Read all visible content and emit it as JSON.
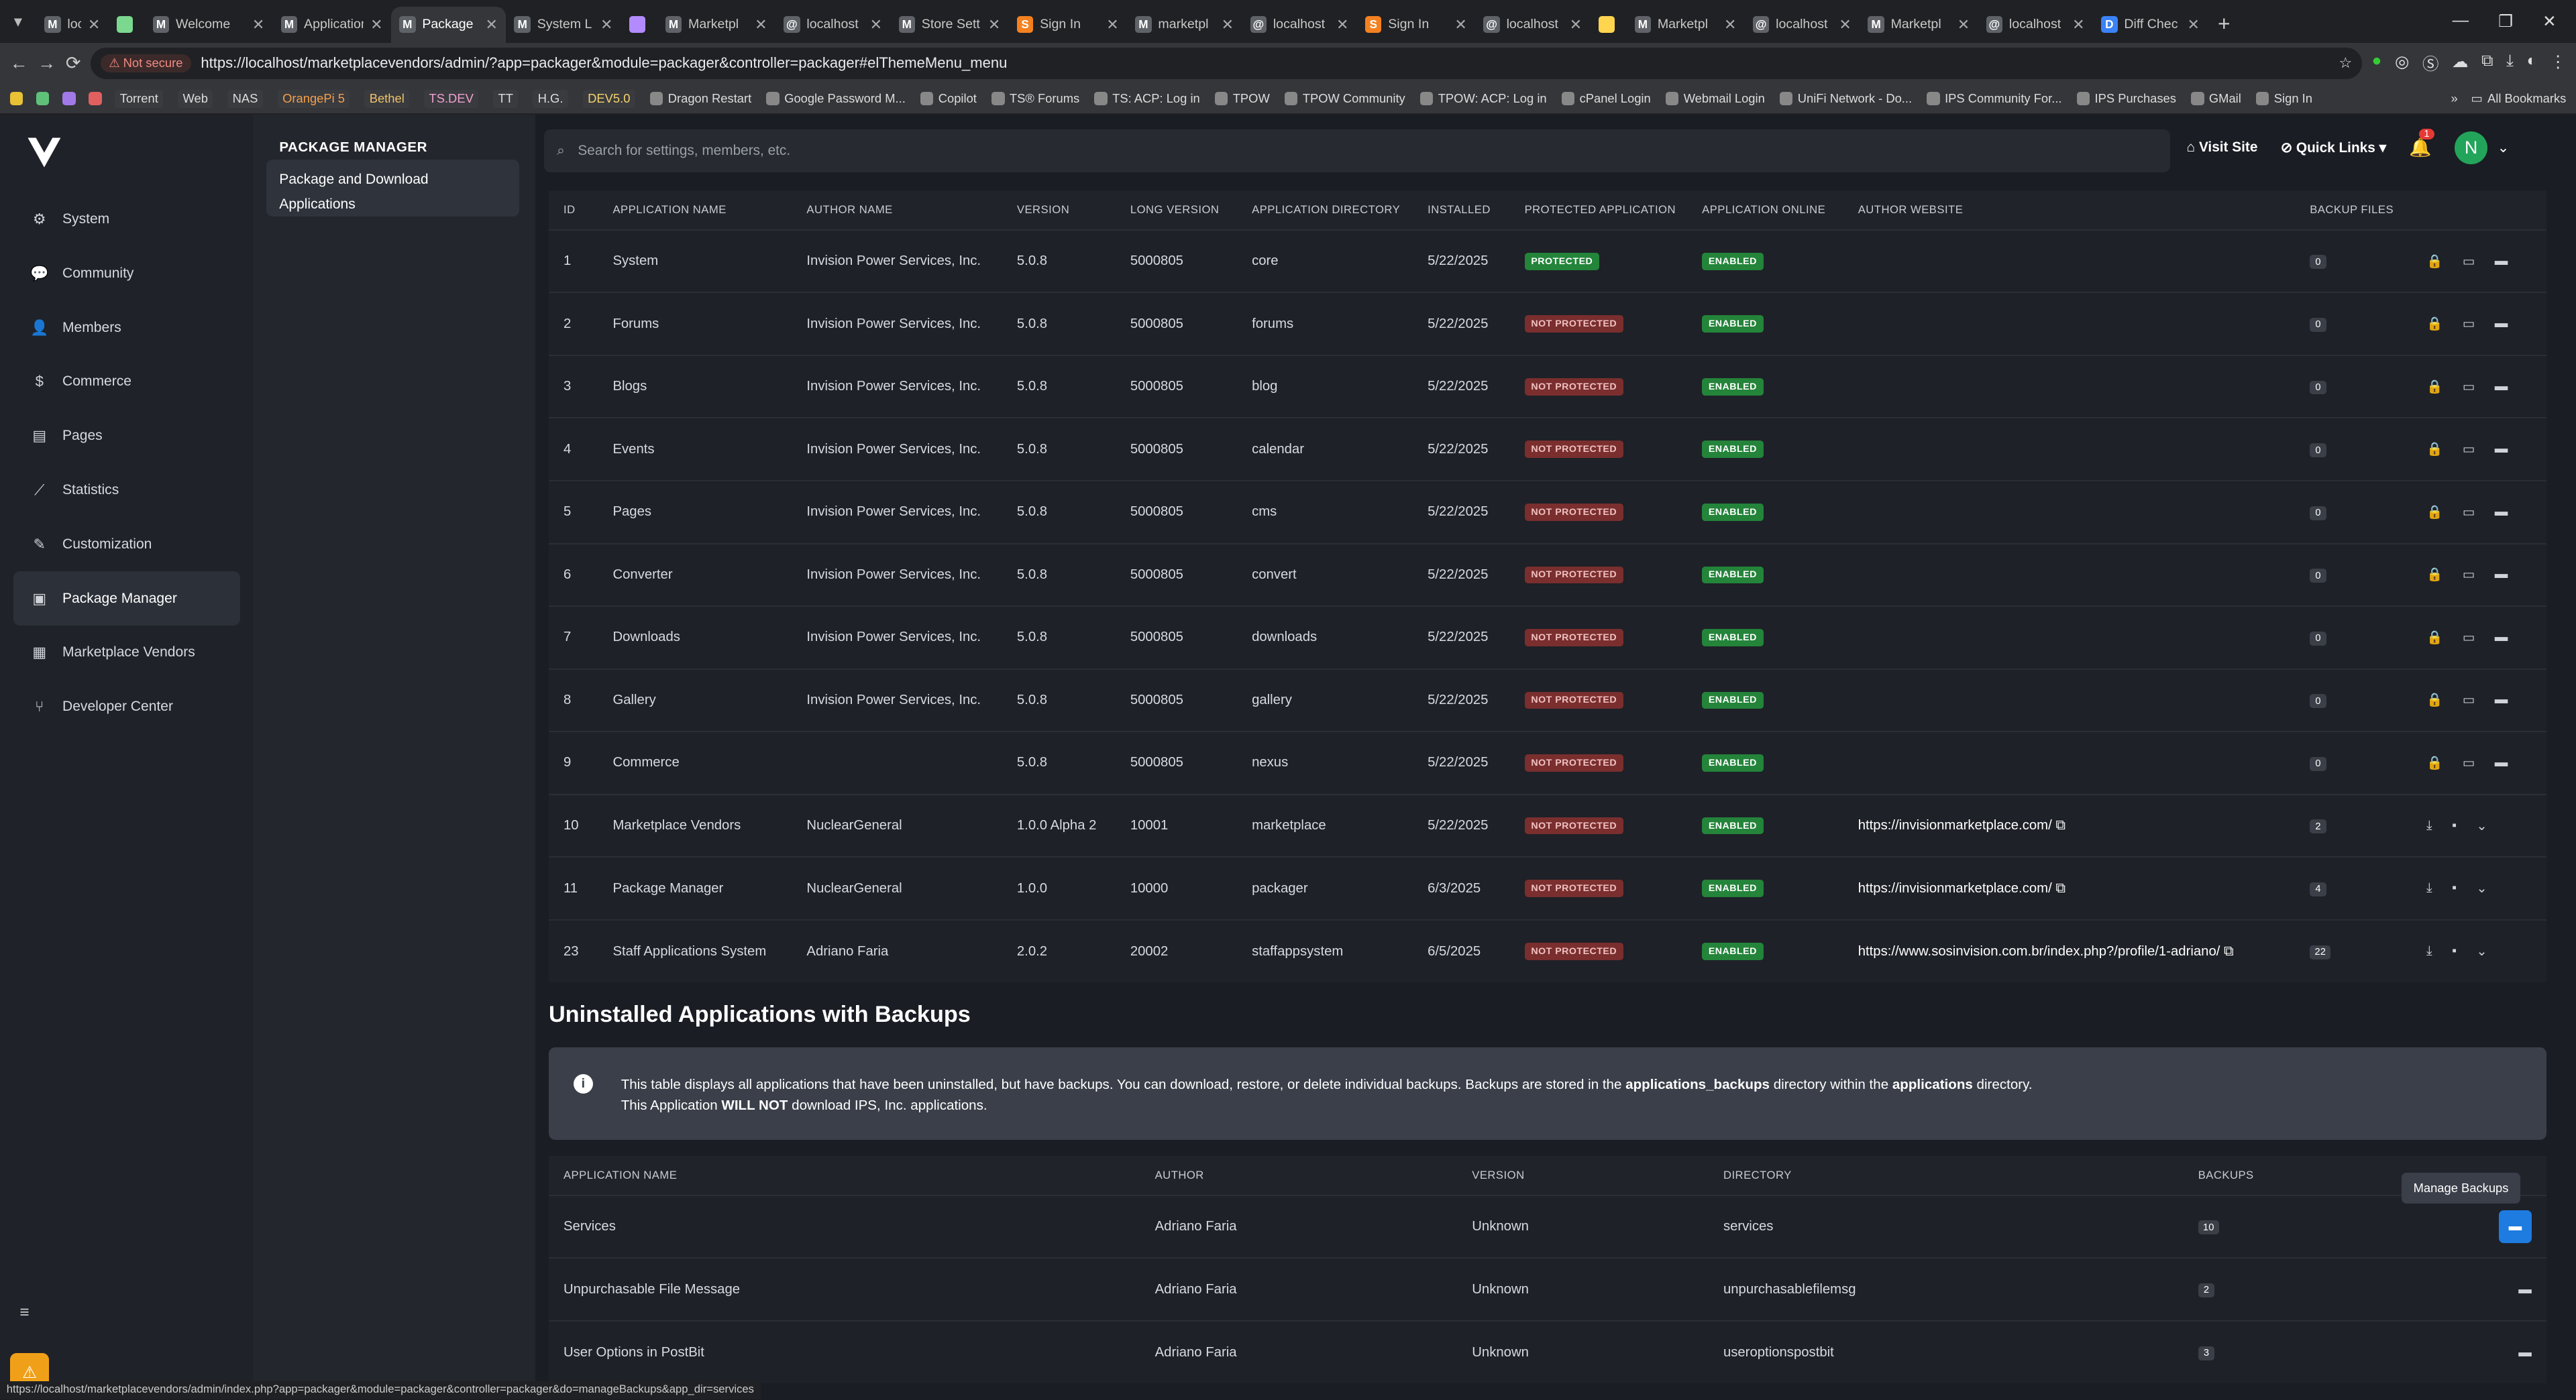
{
  "browser": {
    "tabs": [
      {
        "label": "localhost",
        "icon": "M"
      },
      {
        "label": "",
        "icon": ""
      },
      {
        "label": "Welcome",
        "icon": "M"
      },
      {
        "label": "Application",
        "icon": "M"
      },
      {
        "label": "Package",
        "icon": "M",
        "active": true
      },
      {
        "label": "System L",
        "icon": "M"
      },
      {
        "label": "",
        "icon": ""
      },
      {
        "label": "Marketpl",
        "icon": "M"
      },
      {
        "label": "localhost",
        "icon": "@"
      },
      {
        "label": "Store Sett",
        "icon": "M"
      },
      {
        "label": "Sign In",
        "icon": "S"
      },
      {
        "label": "marketpl",
        "icon": "M"
      },
      {
        "label": "localhost",
        "icon": "@"
      },
      {
        "label": "Sign In",
        "icon": "S"
      },
      {
        "label": "localhost",
        "icon": "@"
      },
      {
        "label": "",
        "icon": ""
      },
      {
        "label": "Marketpl",
        "icon": "M"
      },
      {
        "label": "localhost",
        "icon": "@"
      },
      {
        "label": "Marketpl",
        "icon": "M"
      },
      {
        "label": "localhost",
        "icon": "@"
      },
      {
        "label": "Diff Chec",
        "icon": "D"
      }
    ],
    "not_secure": "Not secure",
    "url": "https://localhost/marketplacevendors/admin/?app=packager&module=packager&controller=packager#elThemeMenu_menu",
    "bookmarks": [
      "Torrent",
      "Web",
      "NAS",
      "OrangePi 5",
      "Bethel",
      "TS.DEV",
      "TT",
      "H.G.",
      "DEV5.0",
      "Dragon Restart",
      "Google Password M...",
      "Copilot",
      "TS® Forums",
      "TS: ACP: Log in",
      "TPOW",
      "TPOW Community",
      "TPOW: ACP: Log in",
      "cPanel Login",
      "Webmail Login",
      "UniFi Network - Do...",
      "IPS Community For...",
      "IPS Purchases",
      "GMail",
      "Sign In"
    ],
    "all_bookmarks": "All Bookmarks",
    "status_url": "https://localhost/marketplacevendors/admin/index.php?app=packager&module=packager&controller=packager&do=manageBackups&app_dir=services"
  },
  "sidebar": {
    "items": [
      {
        "label": "System",
        "icon": "gears-icon"
      },
      {
        "label": "Community",
        "icon": "comments-icon"
      },
      {
        "label": "Members",
        "icon": "user-icon"
      },
      {
        "label": "Commerce",
        "icon": "dollar-icon"
      },
      {
        "label": "Pages",
        "icon": "page-icon"
      },
      {
        "label": "Statistics",
        "icon": "chart-icon"
      },
      {
        "label": "Customization",
        "icon": "brush-icon"
      },
      {
        "label": "Package Manager",
        "icon": "box-icon",
        "active": true
      },
      {
        "label": "Marketplace Vendors",
        "icon": "store-icon"
      },
      {
        "label": "Developer Center",
        "icon": "branch-icon"
      }
    ]
  },
  "subnav": {
    "title": "PACKAGE MANAGER",
    "item": "Package and Download Applications"
  },
  "topbar": {
    "search_placeholder": "Search for settings, members, etc.",
    "visit_site": "Visit Site",
    "quick_links": "Quick Links",
    "notif_count": "1",
    "avatar_letter": "N"
  },
  "installed": {
    "headers": [
      "ID",
      "Application Name",
      "Author Name",
      "Version",
      "Long Version",
      "Application Directory",
      "Installed",
      "Protected Application",
      "Application Online",
      "Author Website",
      "Backup Files",
      ""
    ],
    "rows": [
      {
        "id": "1",
        "name": "System",
        "author": "Invision Power Services, Inc.",
        "version": "5.0.8",
        "long": "5000805",
        "dir": "core",
        "installed": "5/22/2025",
        "protected": "PROTECTED",
        "online": "ENABLED",
        "website": "",
        "backups": "0",
        "kind": "core"
      },
      {
        "id": "2",
        "name": "Forums",
        "author": "Invision Power Services, Inc.",
        "version": "5.0.8",
        "long": "5000805",
        "dir": "forums",
        "installed": "5/22/2025",
        "protected": "NOT PROTECTED",
        "online": "ENABLED",
        "website": "",
        "backups": "0",
        "kind": "core"
      },
      {
        "id": "3",
        "name": "Blogs",
        "author": "Invision Power Services, Inc.",
        "version": "5.0.8",
        "long": "5000805",
        "dir": "blog",
        "installed": "5/22/2025",
        "protected": "NOT PROTECTED",
        "online": "ENABLED",
        "website": "",
        "backups": "0",
        "kind": "core"
      },
      {
        "id": "4",
        "name": "Events",
        "author": "Invision Power Services, Inc.",
        "version": "5.0.8",
        "long": "5000805",
        "dir": "calendar",
        "installed": "5/22/2025",
        "protected": "NOT PROTECTED",
        "online": "ENABLED",
        "website": "",
        "backups": "0",
        "kind": "core"
      },
      {
        "id": "5",
        "name": "Pages",
        "author": "Invision Power Services, Inc.",
        "version": "5.0.8",
        "long": "5000805",
        "dir": "cms",
        "installed": "5/22/2025",
        "protected": "NOT PROTECTED",
        "online": "ENABLED",
        "website": "",
        "backups": "0",
        "kind": "core"
      },
      {
        "id": "6",
        "name": "Converter",
        "author": "Invision Power Services, Inc.",
        "version": "5.0.8",
        "long": "5000805",
        "dir": "convert",
        "installed": "5/22/2025",
        "protected": "NOT PROTECTED",
        "online": "ENABLED",
        "website": "",
        "backups": "0",
        "kind": "core"
      },
      {
        "id": "7",
        "name": "Downloads",
        "author": "Invision Power Services, Inc.",
        "version": "5.0.8",
        "long": "5000805",
        "dir": "downloads",
        "installed": "5/22/2025",
        "protected": "NOT PROTECTED",
        "online": "ENABLED",
        "website": "",
        "backups": "0",
        "kind": "core"
      },
      {
        "id": "8",
        "name": "Gallery",
        "author": "Invision Power Services, Inc.",
        "version": "5.0.8",
        "long": "5000805",
        "dir": "gallery",
        "installed": "5/22/2025",
        "protected": "NOT PROTECTED",
        "online": "ENABLED",
        "website": "",
        "backups": "0",
        "kind": "core"
      },
      {
        "id": "9",
        "name": "Commerce",
        "author": "",
        "version": "5.0.8",
        "long": "5000805",
        "dir": "nexus",
        "installed": "5/22/2025",
        "protected": "NOT PROTECTED",
        "online": "ENABLED",
        "website": "",
        "backups": "0",
        "kind": "core"
      },
      {
        "id": "10",
        "name": "Marketplace Vendors",
        "author": "NuclearGeneral",
        "version": "1.0.0 Alpha 2",
        "long": "10001",
        "dir": "marketplace",
        "installed": "5/22/2025",
        "protected": "NOT PROTECTED",
        "online": "ENABLED",
        "website": "https://invisionmarketplace.com/",
        "backups": "2",
        "kind": "third"
      },
      {
        "id": "11",
        "name": "Package Manager",
        "author": "NuclearGeneral",
        "version": "1.0.0",
        "long": "10000",
        "dir": "packager",
        "installed": "6/3/2025",
        "protected": "NOT PROTECTED",
        "online": "ENABLED",
        "website": "https://invisionmarketplace.com/",
        "backups": "4",
        "kind": "third"
      },
      {
        "id": "23",
        "name": "Staff Applications System",
        "author": "Adriano Faria",
        "version": "2.0.2",
        "long": "20002",
        "dir": "staffappsystem",
        "installed": "6/5/2025",
        "protected": "NOT PROTECTED",
        "online": "ENABLED",
        "website": "https://www.sosinvision.com.br/index.php?/profile/1-adriano/",
        "backups": "22",
        "kind": "third"
      }
    ]
  },
  "uninstalled": {
    "title": "Uninstalled Applications with Backups",
    "info_line1_a": "This table displays all applications that have been uninstalled, but have backups. You can download, restore, or delete individual backups. Backups are stored in the ",
    "info_bold1": "applications_backups",
    "info_line1_b": " directory within the ",
    "info_bold2": "applications",
    "info_line1_c": " directory.",
    "info_line2_a": "This Application ",
    "info_bold3": "WILL NOT",
    "info_line2_b": " download IPS, Inc. applications.",
    "headers": [
      "Application Name",
      "Author",
      "Version",
      "Directory",
      "Backups",
      ""
    ],
    "rows": [
      {
        "name": "Services",
        "author": "Adriano Faria",
        "version": "Unknown",
        "dir": "services",
        "backups": "10",
        "highlight": true
      },
      {
        "name": "Unpurchasable File Message",
        "author": "Adriano Faria",
        "version": "Unknown",
        "dir": "unpurchasablefilemsg",
        "backups": "2"
      },
      {
        "name": "User Options in PostBit",
        "author": "Adriano Faria",
        "version": "Unknown",
        "dir": "useroptionspostbit",
        "backups": "3"
      }
    ],
    "tooltip": "Manage Backups"
  },
  "colors": {
    "accent": "#1e7be0",
    "enabled": "#23843a",
    "not_protected": "#7a2e2e",
    "avatar": "#22a55b"
  }
}
